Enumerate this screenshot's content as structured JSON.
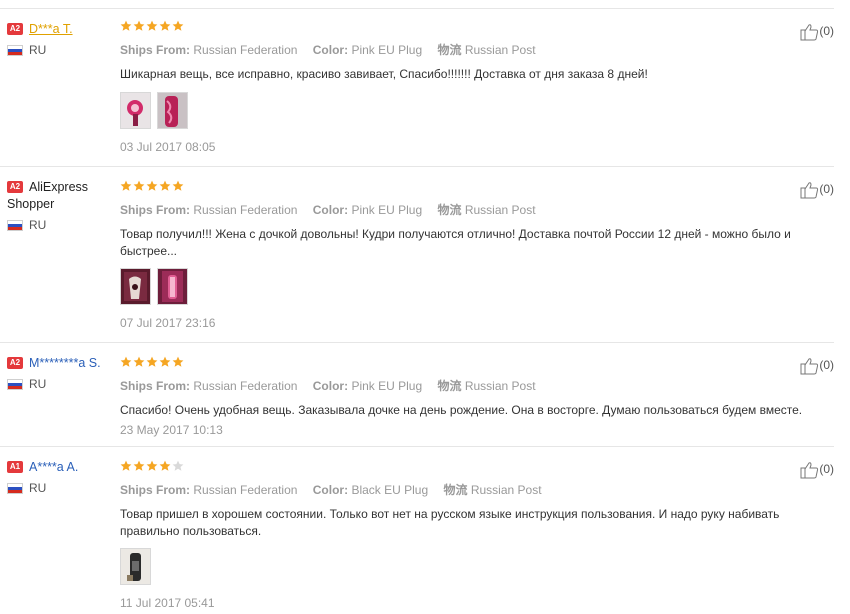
{
  "reviews": [
    {
      "level": "A2",
      "user": "D***a T.",
      "country": "RU",
      "stars": 5,
      "ships_from_label": "Ships From:",
      "ships_from": "Russian Federation",
      "color_label": "Color:",
      "color": "Pink EU Plug",
      "logistics_label": "物流",
      "logistics": "Russian Post",
      "text": "Шикарная вещь, все исправно, красиво завивает, Спасибо!!!!!!! Доставка от дня заказа 8 дней!",
      "date": "03 Jul 2017 08:05",
      "useful_count": "(0)",
      "photo_count": 2
    },
    {
      "level": "A2",
      "user": "AliExpress Shopper",
      "country": "RU",
      "stars": 5,
      "ships_from_label": "Ships From:",
      "ships_from": "Russian Federation",
      "color_label": "Color:",
      "color": "Pink EU Plug",
      "logistics_label": "物流",
      "logistics": "Russian Post",
      "text": "Товар получил!!! Жена с дочкой довольны! Кудри получаются отлично! Доставка почтой России 12 дней - можно было и быстрее...",
      "date": "07 Jul 2017 23:16",
      "useful_count": "(0)",
      "photo_count": 2
    },
    {
      "level": "A2",
      "user": "M********a S.",
      "country": "RU",
      "stars": 5,
      "ships_from_label": "Ships From:",
      "ships_from": "Russian Federation",
      "color_label": "Color:",
      "color": "Pink EU Plug",
      "logistics_label": "物流",
      "logistics": "Russian Post",
      "text": "Спасибо! Очень удобная вещь. Заказывала дочке на день рождение. Она в восторге. Думаю пользоваться будем вместе.",
      "date": "23 May 2017 10:13",
      "useful_count": "(0)",
      "photo_count": 0
    },
    {
      "level": "A1",
      "user": "A****a A.",
      "country": "RU",
      "stars": 4,
      "ships_from_label": "Ships From:",
      "ships_from": "Russian Federation",
      "color_label": "Color:",
      "color": "Black EU Plug",
      "logistics_label": "物流",
      "logistics": "Russian Post",
      "text": "Товар пришел в хорошем состоянии. Только вот нет на русском языке инструкция пользования. И надо руку набивать правильно пользоваться.",
      "date": "11 Jul 2017 05:41",
      "useful_count": "(0)",
      "photo_count": 1
    }
  ],
  "colors": {
    "star": "#f5a623",
    "star_empty": "#d9d9d9",
    "badge": "#e4393c",
    "user_gold": "#e0a100",
    "user_blue": "#2a5fb8"
  },
  "icons": {
    "useful": "thumbs-up-icon",
    "flag": "russia-flag-icon",
    "star": "star-icon"
  }
}
